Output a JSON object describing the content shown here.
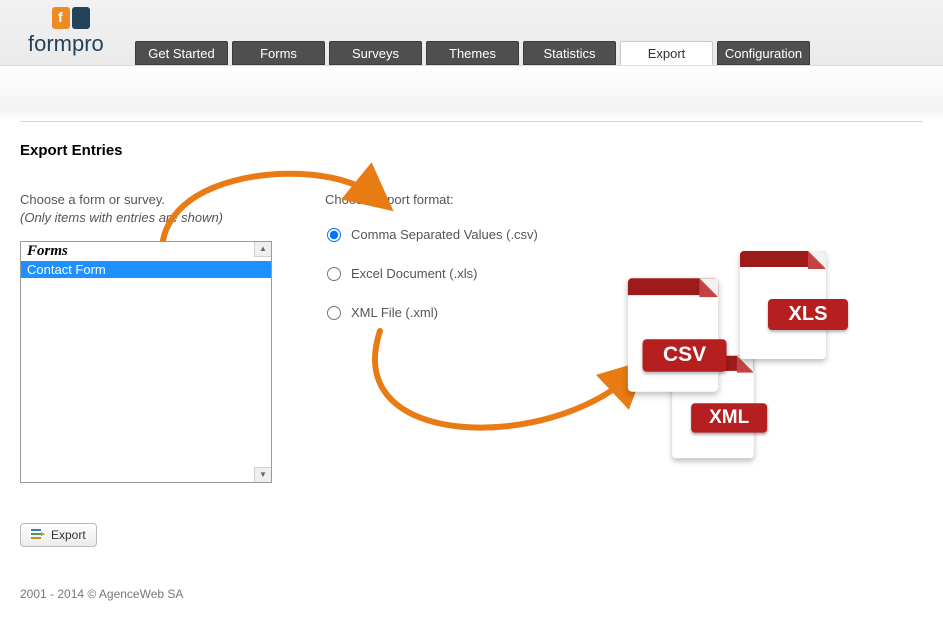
{
  "logo": {
    "text": "formpro"
  },
  "tabs": {
    "items": [
      {
        "label": "Get Started"
      },
      {
        "label": "Forms"
      },
      {
        "label": "Surveys"
      },
      {
        "label": "Themes"
      },
      {
        "label": "Statistics"
      },
      {
        "label": "Export"
      },
      {
        "label": "Configuration"
      }
    ],
    "active_index": 5
  },
  "page": {
    "title": "Export Entries",
    "choose_form_label": "Choose a form or survey.",
    "choose_form_hint": "(Only items with entries are shown)",
    "listbox": {
      "header": "Forms",
      "items": [
        {
          "label": "Contact Form",
          "selected": true
        }
      ]
    },
    "choose_format_label": "Choose export format:",
    "formats": [
      {
        "label": "Comma Separated Values (.csv)",
        "checked": true
      },
      {
        "label": "Excel Document (.xls)",
        "checked": false
      },
      {
        "label": "XML File (.xml)",
        "checked": false
      }
    ],
    "export_button": "Export",
    "file_badges": {
      "csv": "CSV",
      "xls": "XLS",
      "xml": "XML"
    },
    "footer": "2001 - 2014 © AgenceWeb SA"
  },
  "colors": {
    "accent_orange": "#e87b13",
    "tab_dark": "#4f4f4f",
    "selection_blue": "#1e90ff",
    "badge_red": "#b51f1f"
  }
}
